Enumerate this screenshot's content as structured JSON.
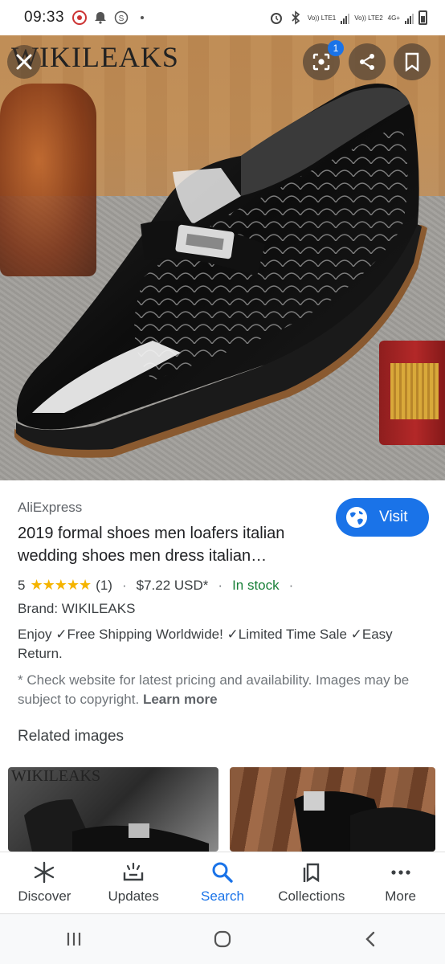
{
  "status_bar": {
    "time": "09:33",
    "network_1": "Vo)) LTE1",
    "network_2": "Vo)) LTE2",
    "network_type": "4G+"
  },
  "hero": {
    "watermark": "WIKILEAKS",
    "lens_badge_count": "1",
    "icons": [
      "close-icon",
      "lens-icon",
      "share-icon",
      "bookmark-icon"
    ]
  },
  "result": {
    "source": "AliExpress",
    "visit_label": "Visit",
    "title": "2019 formal shoes men loafers italian wedding shoes men dress italian…",
    "rating": "5",
    "stars": "★★★★★",
    "review_count": "(1)",
    "price": "$7.22 USD*",
    "availability": "In stock",
    "brand": "Brand: WIKILEAKS",
    "description": "Enjoy ✓Free Shipping Worldwide! ✓Limited Time Sale ✓Easy Return.",
    "disclaimer": "* Check website for latest pricing and availability. Images may be subject to copyright.",
    "learn_more": "Learn more"
  },
  "related": {
    "title": "Related images",
    "thumb1_watermark": "WIKILEAKS"
  },
  "bottom_nav": {
    "items": [
      {
        "label": "Discover",
        "icon": "asterisk-icon"
      },
      {
        "label": "Updates",
        "icon": "updates-icon"
      },
      {
        "label": "Search",
        "icon": "search-icon",
        "active": true
      },
      {
        "label": "Collections",
        "icon": "collections-icon"
      },
      {
        "label": "More",
        "icon": "more-icon"
      }
    ]
  },
  "colors": {
    "accent": "#1a73e8",
    "in_stock": "#188038",
    "star": "#f5b400"
  }
}
